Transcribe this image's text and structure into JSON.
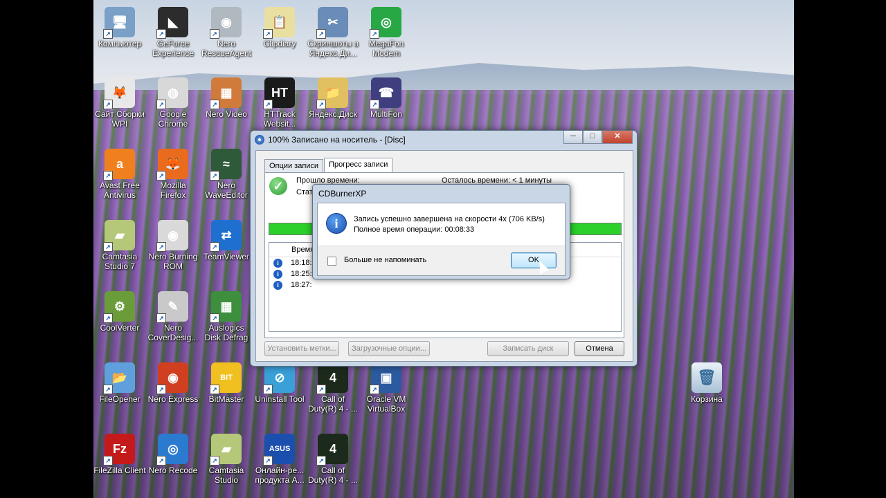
{
  "desktop": {
    "icons": [
      {
        "label": "Компьютер",
        "icon": "computer-icon",
        "color": "#7aa0c8",
        "glyph": "🖥"
      },
      {
        "label": "GeForce Experience",
        "icon": "geforce-icon",
        "color": "#2c2c2c",
        "glyph": "◣"
      },
      {
        "label": "Nero RescueAgent",
        "icon": "nero-rescue-icon",
        "color": "#b0b8c0",
        "glyph": "◉"
      },
      {
        "label": "Clipdiary",
        "icon": "clipdiary-icon",
        "color": "#e8dfa0",
        "glyph": "📋"
      },
      {
        "label": "Скриншоты в Яндекс.Ди...",
        "icon": "yandex-screenshot-icon",
        "color": "#6a8cb8",
        "glyph": "✂"
      },
      {
        "label": "MegaFon Modem",
        "icon": "megafon-icon",
        "color": "#27a845",
        "glyph": "◎"
      },
      {
        "label": "Сайт Сборки WPI",
        "icon": "wpi-site-icon",
        "color": "#e8e8e8",
        "glyph": "🦊"
      },
      {
        "label": "Google Chrome",
        "icon": "chrome-icon",
        "color": "#d8d8d8",
        "glyph": "◍"
      },
      {
        "label": "Nero Video",
        "icon": "nero-video-icon",
        "color": "#d07b3c",
        "glyph": "▦"
      },
      {
        "label": "HTTrack Websit...",
        "icon": "httrack-icon",
        "color": "#1a1a1a",
        "glyph": "HT"
      },
      {
        "label": "Яндекс.Диск",
        "icon": "yandex-disk-icon",
        "color": "#e0c060",
        "glyph": "📁"
      },
      {
        "label": "MultiFon",
        "icon": "multifon-icon",
        "color": "#3f3f7f",
        "glyph": "☎"
      },
      {
        "label": "Avast Free Antivirus",
        "icon": "avast-icon",
        "color": "#f07f1e",
        "glyph": "a"
      },
      {
        "label": "Mozilla Firefox",
        "icon": "firefox-icon",
        "color": "#e86b1e",
        "glyph": "🦊"
      },
      {
        "label": "Nero WaveEditor",
        "icon": "nero-wave-icon",
        "color": "#2f5a3a",
        "glyph": "≈"
      },
      {
        "label": "Camtasia Studio 7",
        "icon": "camtasia-icon",
        "color": "#b5c879",
        "glyph": "▰"
      },
      {
        "label": "Nero Burning ROM",
        "icon": "nero-burning-icon",
        "color": "#d9d9d9",
        "glyph": "◉"
      },
      {
        "label": "TeamViewer",
        "icon": "teamviewer-icon",
        "color": "#1e6fd0",
        "glyph": "⇄"
      },
      {
        "label": "CoolVerter",
        "icon": "coolverter-icon",
        "color": "#6b9c3a",
        "glyph": "⚙"
      },
      {
        "label": "Nero CoverDesig...",
        "icon": "nero-cover-icon",
        "color": "#c9c9c9",
        "glyph": "✎"
      },
      {
        "label": "Auslogics Disk Defrag",
        "icon": "auslogics-icon",
        "color": "#3d8f3d",
        "glyph": "▦"
      },
      {
        "label": "FileOpener",
        "icon": "fileopener-icon",
        "color": "#5fa0dc",
        "glyph": "📂"
      },
      {
        "label": "Nero Express",
        "icon": "nero-express-icon",
        "color": "#d04020",
        "glyph": "◉"
      },
      {
        "label": "BitMaster",
        "icon": "bitmaster-icon",
        "color": "#f0c020",
        "glyph": "BIT"
      },
      {
        "label": "Uninstall Tool",
        "icon": "uninstall-icon",
        "color": "#3aa0d8",
        "glyph": "⊘"
      },
      {
        "label": "Call of Duty(R) 4 - ...",
        "icon": "cod4-icon",
        "color": "#1c2a1c",
        "glyph": "4"
      },
      {
        "label": "Oracle VM VirtualBox",
        "icon": "virtualbox-icon",
        "color": "#2c5aa0",
        "glyph": "▣"
      },
      {
        "label": "FileZilla Client",
        "icon": "filezilla-icon",
        "color": "#c41a1a",
        "glyph": "Fz"
      },
      {
        "label": "Nero Recode",
        "icon": "nero-recode-icon",
        "color": "#2a7ad0",
        "glyph": "◎"
      },
      {
        "label": "Camtasia Studio",
        "icon": "camtasia2-icon",
        "color": "#b5c879",
        "glyph": "▰"
      },
      {
        "label": "Онлайн-ре... продукта A...",
        "icon": "asus-icon",
        "color": "#1a4fae",
        "glyph": "ASUS"
      },
      {
        "label": "Call of Duty(R) 4 - ...",
        "icon": "cod4-mp-icon",
        "color": "#1c2a1c",
        "glyph": "4"
      }
    ],
    "recycle": {
      "label": "Корзина",
      "icon": "recycle-bin-icon"
    }
  },
  "window": {
    "title": "100% Записано на носитель - [Disc]",
    "controls": {
      "minimize": "─",
      "maximize": "□",
      "close": "✕"
    },
    "tabs": [
      "Опции записи",
      "Прогресс записи"
    ],
    "elapsed_label": "Прошло времени:",
    "remaining_label": "Осталось времени: < 1 минуты",
    "status_label": "Стат",
    "progress": 1.0,
    "log_header": "Время",
    "log_rows": [
      "18:18:",
      "18:25:",
      "18:27:"
    ],
    "buttons": {
      "set_labels": "Установить метки...",
      "boot_options": "Загрузочные опции...",
      "burn": "Записать диск",
      "cancel": "Отмена"
    }
  },
  "dialog": {
    "title": "CDBurnerXP",
    "message_line1": "Запись успешно завершена на скорости 4x (706 KB/s)",
    "message_line2": "Полное время операции: 00:08:33",
    "checkbox_label": "Больше не напоминать",
    "ok": "OK"
  }
}
